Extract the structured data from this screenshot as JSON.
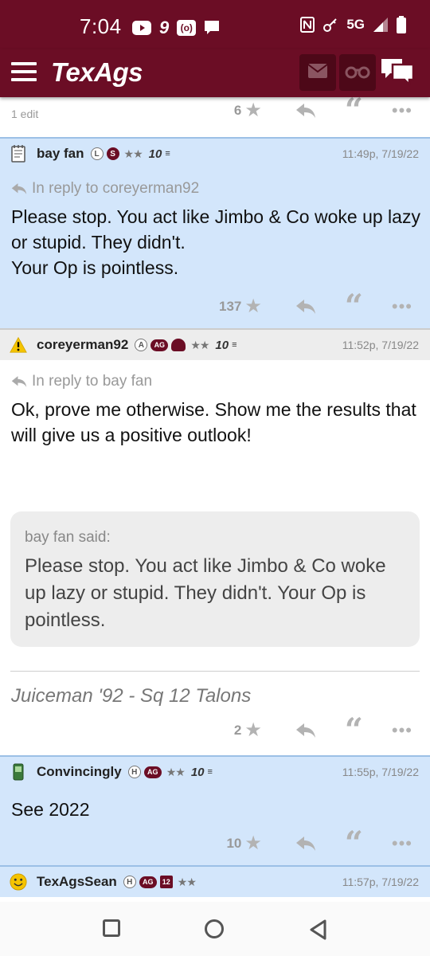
{
  "status": {
    "time": "7:04",
    "icons_left": [
      "youtube-icon",
      "nine-icon",
      "radio-icon",
      "message-icon"
    ],
    "network": "5G",
    "icons_right": [
      "nfc-icon",
      "key-icon",
      "signal-icon",
      "battery-icon"
    ]
  },
  "appbar": {
    "logo": "TexAgs",
    "icons": [
      "mail-icon",
      "binoculars-icon",
      "chat-icon"
    ]
  },
  "post0": {
    "edit_note": "1 edit",
    "likes": "6"
  },
  "post1": {
    "username": "bay fan",
    "badges": [
      "L",
      "S"
    ],
    "rank": "★★",
    "level": "10",
    "timestamp": "11:49p, 7/19/22",
    "reply_to": "In reply to coreyerman92",
    "body": "Please stop. You act like Jimbo & Co woke up lazy or stupid. They didn't.\nYour Op is pointless.",
    "likes": "137"
  },
  "post2": {
    "username": "coreyerman92",
    "badges": [
      "A",
      "AG"
    ],
    "rank": "★★",
    "level": "10",
    "timestamp": "11:52p, 7/19/22",
    "reply_to": "In reply to bay fan",
    "body": "Ok, prove me otherwise. Show me the results that will give us a positive outlook!",
    "quote_author": "bay fan said:",
    "quote_text": "Please stop. You act like Jimbo & Co woke up lazy or stupid. They didn't. Your Op is pointless.",
    "signature": "Juiceman '92 - Sq 12 Talons",
    "likes": "2"
  },
  "post3": {
    "username": "Convincingly",
    "badges": [
      "H",
      "AG"
    ],
    "rank": "★★",
    "level": "10",
    "timestamp": "11:55p, 7/19/22",
    "body": "See 2022",
    "likes": "10"
  },
  "post4": {
    "username": "TexAgsSean",
    "badges": [
      "H",
      "AG",
      "12"
    ],
    "rank": "★★",
    "timestamp": "11:57p, 7/19/22"
  },
  "colors": {
    "maroon": "#6b0d25",
    "post_blue": "#d3e6fb",
    "header_gray": "#ededed"
  }
}
